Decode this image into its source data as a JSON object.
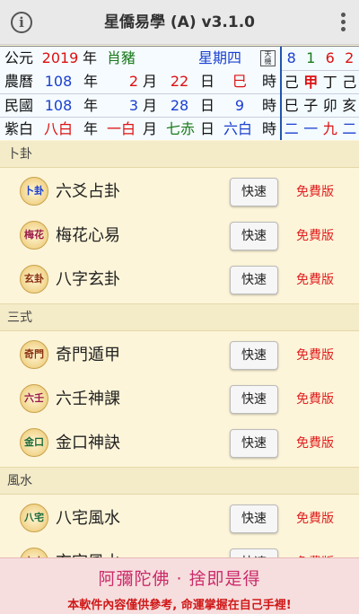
{
  "header": {
    "title": "星僑易學 (A) v3.1.0",
    "info_icon": "info-icon",
    "menu_icon": "more-vert-icon"
  },
  "calendar": {
    "gregorian": {
      "label": "公元",
      "year": "2019",
      "year_unit": "年",
      "zodiac": "肖豬",
      "weekday": "星期四"
    },
    "stamp_text": "天機",
    "lunar": {
      "label": "農曆",
      "year": "108",
      "year_unit": "年",
      "month": "2",
      "month_unit": "月",
      "day": "22",
      "day_unit": "日",
      "hour": "巳",
      "hour_unit": "時"
    },
    "minguo": {
      "label": "民國",
      "year": "108",
      "year_unit": "年",
      "month": "3",
      "month_unit": "月",
      "day": "28",
      "day_unit": "日",
      "hour": "9",
      "hour_unit": "時"
    },
    "stars": {
      "label": "紫白",
      "year": "八白",
      "year_unit": "年",
      "month": "一白",
      "month_unit": "月",
      "day": "七赤",
      "day_unit": "日",
      "hour": "六白",
      "hour_unit": "時"
    },
    "right": [
      [
        "8",
        "1",
        "6",
        "2"
      ],
      [
        "己",
        "甲",
        "丁",
        "己"
      ],
      [
        "巳",
        "子",
        "卯",
        "亥"
      ],
      [
        "二",
        "一",
        "九",
        "二"
      ]
    ]
  },
  "sections": [
    {
      "title": "卜卦",
      "items": [
        {
          "badge": "卜卦",
          "name": "六爻占卦",
          "quick": "快速",
          "free": "免費版"
        },
        {
          "badge": "梅花",
          "name": "梅花心易",
          "quick": "快速",
          "free": "免費版"
        },
        {
          "badge": "玄卦",
          "name": "八字玄卦",
          "quick": "快速",
          "free": "免費版"
        }
      ]
    },
    {
      "title": "三式",
      "items": [
        {
          "badge": "奇門",
          "name": "奇門遁甲",
          "quick": "快速",
          "free": "免費版"
        },
        {
          "badge": "六壬",
          "name": "六壬神課",
          "quick": "快速",
          "free": "免費版"
        },
        {
          "badge": "金口",
          "name": "金口神訣",
          "quick": "快速",
          "free": "免費版"
        }
      ]
    },
    {
      "title": "風水",
      "items": [
        {
          "badge": "八宅",
          "name": "八宅風水",
          "quick": "快速",
          "free": "免費版"
        },
        {
          "badge": "玄空",
          "name": "玄空風水",
          "quick": "快速",
          "free": "免費版"
        }
      ]
    }
  ],
  "footer": {
    "motto": "阿彌陀佛 · 捨即是得",
    "note": "本軟件內容僅供參考, 命運掌握在自己手裡!"
  },
  "colors": {
    "accent_red": "#e02020",
    "motto_pink": "#cc2a6a",
    "accent_blue": "#1a3fd0",
    "accent_green": "#1a7a1a"
  }
}
